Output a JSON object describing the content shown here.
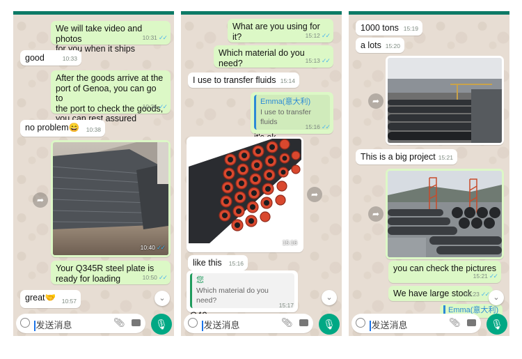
{
  "panel1": {
    "messages": [
      {
        "text": "We will take video and photos\nfor you when it ships",
        "time": "10:31",
        "read": true
      },
      {
        "text": "good",
        "time": "10:33"
      },
      {
        "text": "After the goods arrive at the\nport of Genoa, you can go to\nthe port to check the goods,\nyou can rest assured",
        "time": "10:36",
        "read": true
      },
      {
        "text": "no problem😄",
        "time": "10:38"
      },
      {
        "text": "Your Q345R steel plate is\nready for loading",
        "time": "10:50",
        "read": true
      },
      {
        "text": "great🤝",
        "time": "10:57"
      }
    ],
    "photo_time": "10:40",
    "input_placeholder": "发送消息"
  },
  "panel2": {
    "messages": [
      {
        "text": "What are you using for it?",
        "time": "15:12",
        "read": true
      },
      {
        "text": "Which material do you need?",
        "time": "15:13",
        "read": true
      },
      {
        "text": "I use to transfer fluids",
        "time": "15:14"
      },
      {
        "text": "it's ok",
        "time": "15:16",
        "read": true
      },
      {
        "text": "like this",
        "time": "15:16"
      },
      {
        "text": "C40",
        "time": "15:17"
      }
    ],
    "quote1": {
      "name": "Emma(意大利)",
      "text": "I use to transfer fluids"
    },
    "quote2": {
      "name": "您",
      "text": "Which material do you need?"
    },
    "photo_time": "15:16",
    "input_placeholder": "发送消息"
  },
  "panel3": {
    "messages": [
      {
        "text": "1000 tons",
        "time": "15:19"
      },
      {
        "text": "a lots",
        "time": "15:20"
      },
      {
        "text": "This is a big project",
        "time": "15:21"
      },
      {
        "text": "you can check the pictures",
        "time": "15:21",
        "read": true
      },
      {
        "text": "We have large stock",
        "time": "15:23",
        "read": true
      }
    ],
    "partial_name": "Emma(意大利)",
    "input_placeholder": "发送消息"
  },
  "colors": {
    "header": "#0d7a66",
    "outgoing": "#dcf8c6",
    "incoming": "#ffffff",
    "chat_bg": "#e7ddd3",
    "mic": "#00a884"
  }
}
